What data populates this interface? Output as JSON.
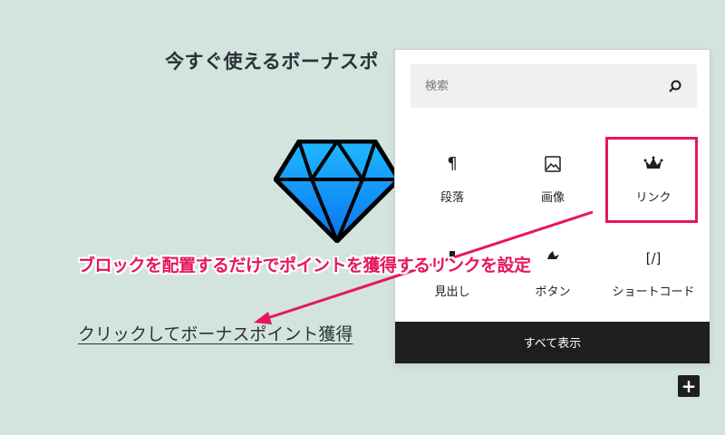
{
  "editor": {
    "heading": "今すぐ使えるボーナスポ",
    "link_text": "クリックしてボーナスポイント獲得"
  },
  "inserter": {
    "search_placeholder": "検索",
    "blocks": [
      {
        "label": "段落",
        "icon": "paragraph-icon",
        "glyph": "¶"
      },
      {
        "label": "画像",
        "icon": "image-icon",
        "glyph": ""
      },
      {
        "label": "リンク",
        "icon": "crown-icon",
        "glyph": ""
      },
      {
        "label": "見出し",
        "icon": "heading-icon",
        "glyph": ""
      },
      {
        "label": "ボタン",
        "icon": "button-icon",
        "glyph": ""
      },
      {
        "label": "ショートコード",
        "icon": "shortcode-icon",
        "glyph": "[/]"
      }
    ],
    "show_all_label": "すべて表示"
  },
  "annotation": {
    "text": "ブロックを配置するだけでポイントを獲得するリンクを設定",
    "color": "#e6155f"
  },
  "colors": {
    "background": "#d3e3dd",
    "accent": "#e6155f",
    "dark": "#1e1e1e"
  }
}
